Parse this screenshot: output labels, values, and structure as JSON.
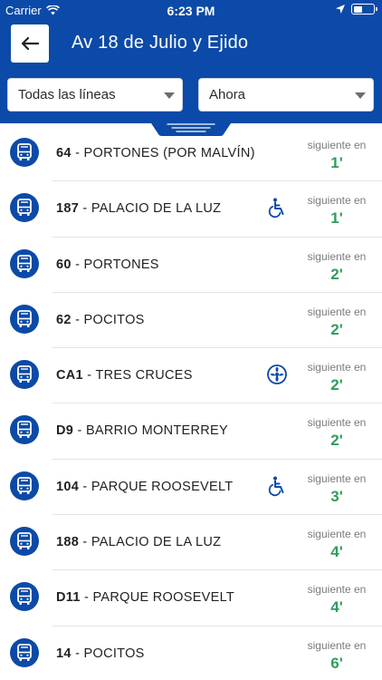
{
  "status": {
    "carrier": "Carrier",
    "time": "6:23 PM"
  },
  "header": {
    "title": "Av 18 de Julio y Ejido"
  },
  "filters": {
    "lines": "Todas las líneas",
    "time": "Ahora"
  },
  "colors": {
    "brand": "#0b4aa8",
    "eta": "#2e9d5b"
  },
  "arrivals": [
    {
      "number": "64",
      "destination": "PORTONES (POR MALVÍN)",
      "next_label": "siguiente en",
      "eta": "1'",
      "accessibility": ""
    },
    {
      "number": "187",
      "destination": "PALACIO DE LA LUZ",
      "next_label": "siguiente en",
      "eta": "1'",
      "accessibility": "wheelchair-icon"
    },
    {
      "number": "60",
      "destination": "PORTONES",
      "next_label": "siguiente en",
      "eta": "2'",
      "accessibility": ""
    },
    {
      "number": "62",
      "destination": "POCITOS",
      "next_label": "siguiente en",
      "eta": "2'",
      "accessibility": ""
    },
    {
      "number": "CA1",
      "destination": "TRES CRUCES",
      "next_label": "siguiente en",
      "eta": "2'",
      "accessibility": "ac-icon"
    },
    {
      "number": "D9",
      "destination": "BARRIO MONTERREY",
      "next_label": "siguiente en",
      "eta": "2'",
      "accessibility": ""
    },
    {
      "number": "104",
      "destination": "PARQUE ROOSEVELT",
      "next_label": "siguiente en",
      "eta": "3'",
      "accessibility": "wheelchair-icon"
    },
    {
      "number": "188",
      "destination": "PALACIO DE LA LUZ",
      "next_label": "siguiente en",
      "eta": "4'",
      "accessibility": ""
    },
    {
      "number": "D11",
      "destination": "PARQUE ROOSEVELT",
      "next_label": "siguiente en",
      "eta": "4'",
      "accessibility": ""
    },
    {
      "number": "14",
      "destination": "POCITOS",
      "next_label": "siguiente en",
      "eta": "6'",
      "accessibility": ""
    }
  ]
}
